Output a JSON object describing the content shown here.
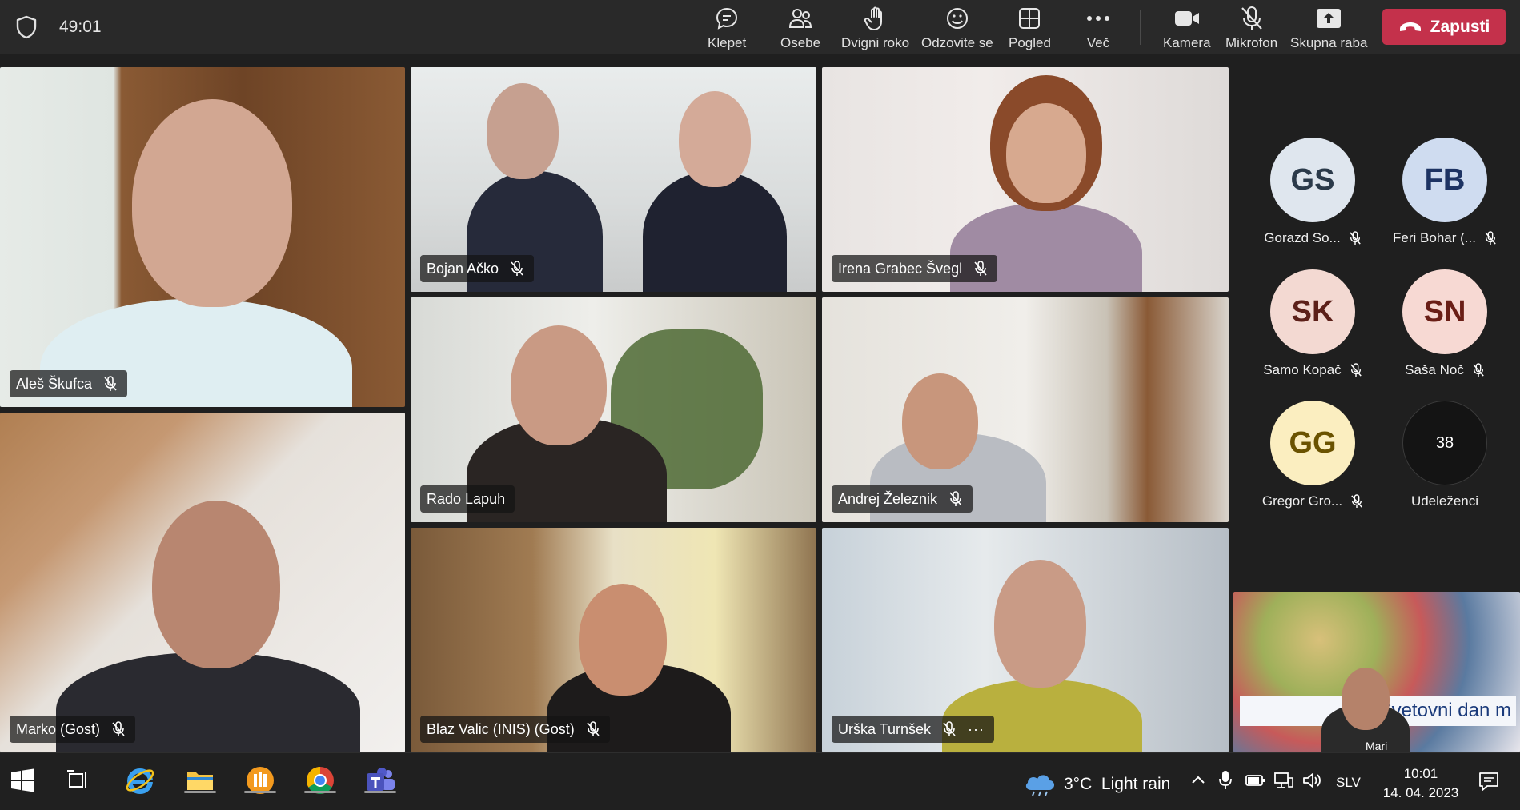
{
  "toolbar": {
    "timer": "49:01",
    "buttons": [
      {
        "label": "Klepet",
        "icon": "chat-icon"
      },
      {
        "label": "Osebe",
        "icon": "people-icon"
      },
      {
        "label": "Dvigni roko",
        "icon": "raise-hand-icon"
      },
      {
        "label": "Odzovite se",
        "icon": "smiley-icon"
      },
      {
        "label": "Pogled",
        "icon": "grid-view-icon"
      },
      {
        "label": "Več",
        "icon": "more-icon"
      },
      {
        "label": "Kamera",
        "icon": "camera-icon"
      },
      {
        "label": "Mikrofon",
        "icon": "mic-off-icon"
      },
      {
        "label": "Skupna raba",
        "icon": "share-icon"
      }
    ],
    "leave_label": "Zapusti",
    "leave_color": "#c4314b"
  },
  "tiles": [
    {
      "name": "Aleš Škufca",
      "muted": true
    },
    {
      "name": "Bojan Ačko",
      "muted": true
    },
    {
      "name": "Irena Grabec Švegl",
      "muted": true
    },
    {
      "name": "Rado Lapuh",
      "muted": false
    },
    {
      "name": "Andrej Železnik",
      "muted": true
    },
    {
      "name": "Marko (Gost)",
      "muted": true
    },
    {
      "name": "Blaz Valic (INIS) (Gost)",
      "muted": true
    },
    {
      "name": "Urška Turnšek",
      "muted": true,
      "more": "···"
    }
  ],
  "roster": [
    {
      "initials": "GS",
      "name": "Gorazd So...",
      "bg": "#dfe6ee",
      "fg": "#2b3a4a"
    },
    {
      "initials": "FB",
      "name": "Feri Bohar (...",
      "bg": "#cfdcf0",
      "fg": "#1d3363"
    },
    {
      "initials": "SK",
      "name": "Samo Kopač",
      "bg": "#f3d9d2",
      "fg": "#5c2019"
    },
    {
      "initials": "SN",
      "name": "Saša Noč",
      "bg": "#f7d9d3",
      "fg": "#6a1e16"
    },
    {
      "initials": "GG",
      "name": "Gregor Gro...",
      "bg": "#fbeec0",
      "fg": "#6a5200"
    }
  ],
  "participants": {
    "count": "38",
    "label": "Udeleženci"
  },
  "shared_screen": {
    "banner_text": "Svetovni dan m",
    "caption": "Mari"
  },
  "taskbar": {
    "weather_temp": "3°C",
    "weather_text": "Light rain",
    "language": "SLV",
    "time": "10:01",
    "date": "14. 04. 2023"
  }
}
